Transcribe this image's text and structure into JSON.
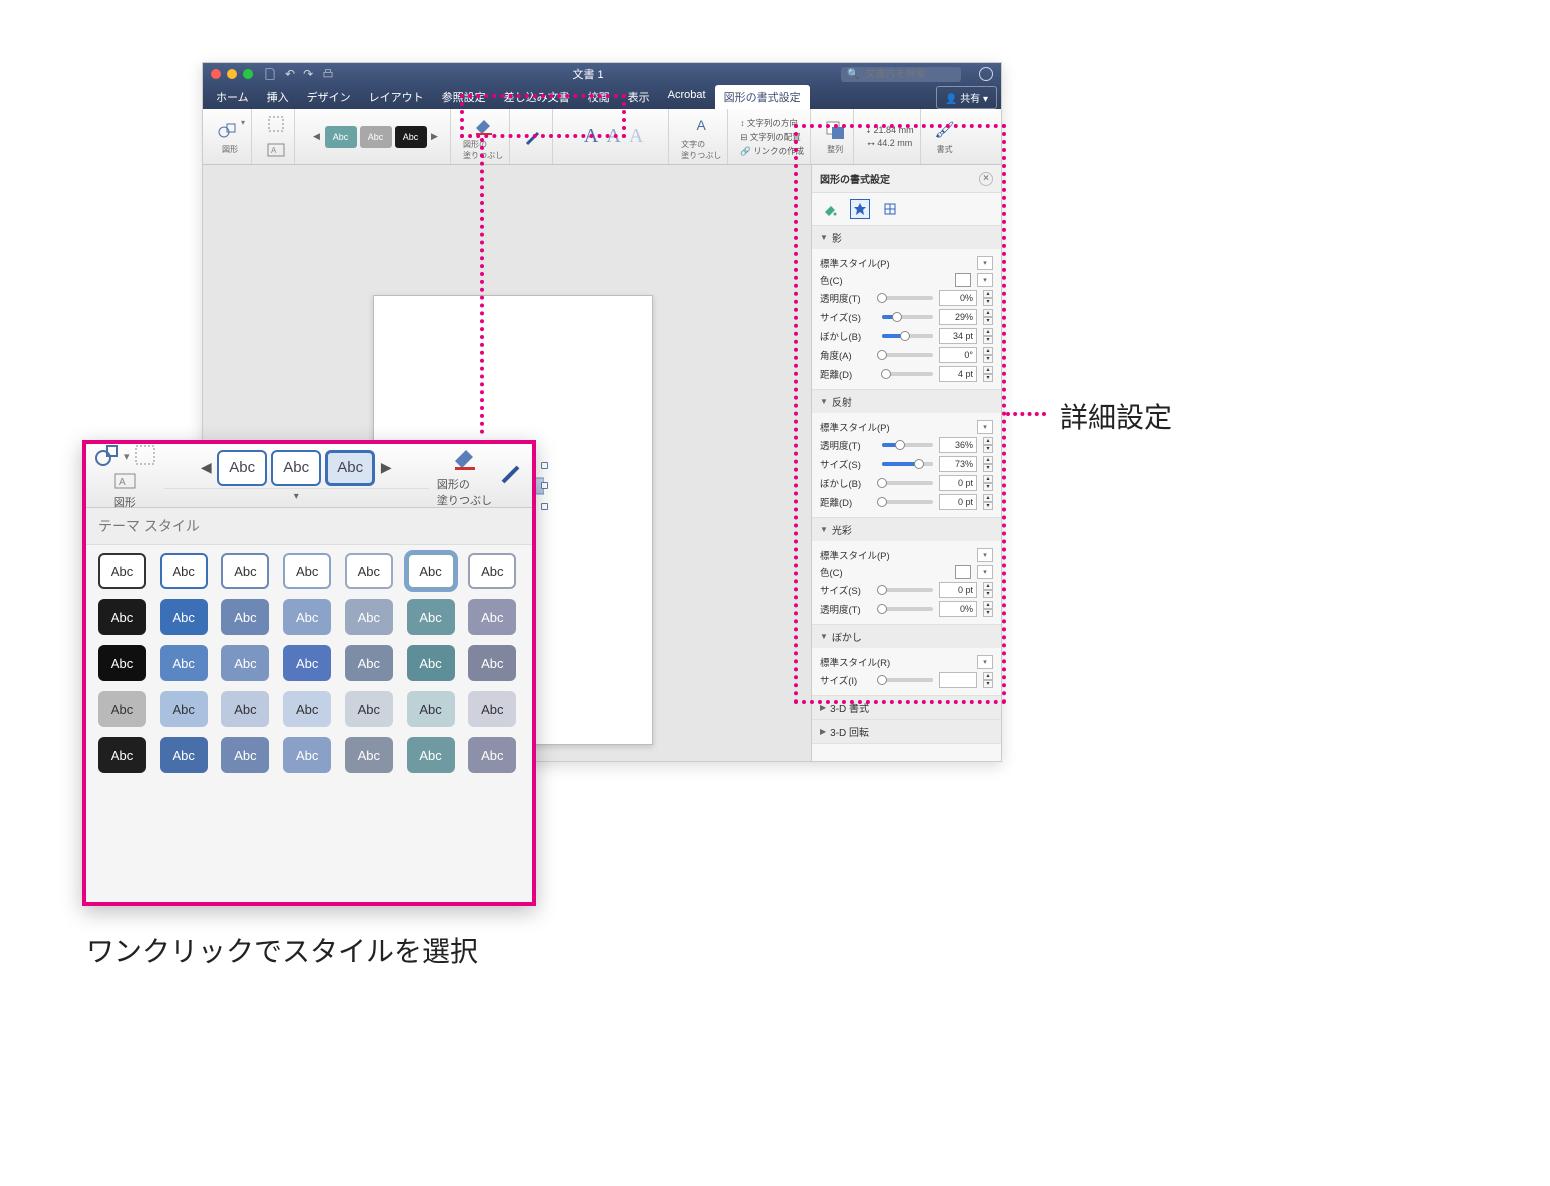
{
  "window": {
    "doc_title": "文書 1",
    "search_placeholder": "文書内を検索",
    "share_label": "共有",
    "tabs": [
      "ホーム",
      "挿入",
      "デザイン",
      "レイアウト",
      "参照設定",
      "差し込み文書",
      "校閲",
      "表示",
      "Acrobat",
      "図形の書式設定"
    ],
    "active_tab_index": 9
  },
  "ribbon": {
    "shape_group": "図形",
    "style_previews": [
      {
        "bg": "#6aa3a3",
        "txt": "Abc"
      },
      {
        "bg": "#a8a8a8",
        "txt": "Abc"
      },
      {
        "bg": "#1b1b1b",
        "txt": "Abc"
      }
    ],
    "fill_label": "図形の\n塗りつぶし",
    "wordart_label": "文字の\n塗りつぶし",
    "text_group": {
      "dir": "文字列の方向",
      "align": "文字列の配置",
      "link": "リンクの作成"
    },
    "arrange_label": "整列",
    "size": {
      "w": "21.84 mm",
      "h": "44.2 mm"
    },
    "format_label": "書式"
  },
  "format_pane": {
    "title": "図形の書式設定",
    "sections": {
      "shadow": {
        "title": "影",
        "rows": {
          "preset": "標準スタイル(P)",
          "color": "色(C)",
          "transparency": {
            "label": "透明度(T)",
            "val": "0%",
            "pct": 0
          },
          "size": {
            "label": "サイズ(S)",
            "val": "29%",
            "pct": 29
          },
          "blur": {
            "label": "ぼかし(B)",
            "val": "34 pt",
            "pct": 45
          },
          "angle": {
            "label": "角度(A)",
            "val": "0°",
            "pct": 0
          },
          "distance": {
            "label": "距離(D)",
            "val": "4 pt",
            "pct": 8
          }
        }
      },
      "reflection": {
        "title": "反射",
        "rows": {
          "preset": "標準スタイル(P)",
          "transparency": {
            "label": "透明度(T)",
            "val": "36%",
            "pct": 36
          },
          "size": {
            "label": "サイズ(S)",
            "val": "73%",
            "pct": 73
          },
          "blur": {
            "label": "ぼかし(B)",
            "val": "0 pt",
            "pct": 0
          },
          "distance": {
            "label": "距離(D)",
            "val": "0 pt",
            "pct": 0
          }
        }
      },
      "glow": {
        "title": "光彩",
        "rows": {
          "preset": "標準スタイル(P)",
          "color": "色(C)",
          "size": {
            "label": "サイズ(S)",
            "val": "0 pt",
            "pct": 0
          },
          "transparency": {
            "label": "透明度(T)",
            "val": "0%",
            "pct": 0
          }
        }
      },
      "softedge": {
        "title": "ぼかし",
        "rows": {
          "preset": "標準スタイル(R)",
          "size": {
            "label": "サイズ(I)",
            "val": "",
            "pct": 0
          }
        }
      },
      "bevel": {
        "title": "3-D 書式"
      },
      "rotation": {
        "title": "3-D 回転"
      }
    }
  },
  "popup": {
    "toolbar": {
      "shape_label": "図形",
      "fill_label": "図形の\n塗りつぶし",
      "styles": [
        "Abc",
        "Abc",
        "Abc"
      ]
    },
    "section_title": "テーマ スタイル",
    "grid": [
      [
        {
          "bg": "#fff",
          "border": "#333",
          "t": "Abc",
          "tw": true
        },
        {
          "bg": "#fff",
          "border": "#3b6fb6",
          "t": "Abc",
          "tw": true
        },
        {
          "bg": "#fff",
          "border": "#6e88b5",
          "t": "Abc",
          "tw": true
        },
        {
          "bg": "#fff",
          "border": "#8ca3c9",
          "t": "Abc",
          "tw": true
        },
        {
          "bg": "#fff",
          "border": "#9aa9bf",
          "t": "Abc",
          "tw": true
        },
        {
          "bg": "#fff",
          "border": "#7fa6b3",
          "t": "Abc",
          "tw": true,
          "sel": true
        },
        {
          "bg": "#fff",
          "border": "#9a9fb8",
          "t": "Abc",
          "tw": true
        }
      ],
      [
        {
          "bg": "#1b1b1b",
          "t": "Abc"
        },
        {
          "bg": "#3b6fb6",
          "t": "Abc"
        },
        {
          "bg": "#6e88b5",
          "t": "Abc"
        },
        {
          "bg": "#8ca3c9",
          "t": "Abc"
        },
        {
          "bg": "#9aa9bf",
          "t": "Abc"
        },
        {
          "bg": "#6d9aa2",
          "t": "Abc"
        },
        {
          "bg": "#9296b0",
          "t": "Abc"
        }
      ],
      [
        {
          "bg": "#0f0f0f",
          "t": "Abc"
        },
        {
          "bg": "#5a86c4",
          "t": "Abc"
        },
        {
          "bg": "#7c96c2",
          "t": "Abc"
        },
        {
          "bg": "#5577bd",
          "t": "Abc"
        },
        {
          "bg": "#7d8da5",
          "t": "Abc"
        },
        {
          "bg": "#5e8f99",
          "t": "Abc"
        },
        {
          "bg": "#81869f",
          "t": "Abc"
        }
      ],
      [
        {
          "bg": "#b9b9b9",
          "t": "Abc",
          "tw": true
        },
        {
          "bg": "#a9c0df",
          "t": "Abc",
          "tw": true
        },
        {
          "bg": "#bcc9de",
          "t": "Abc",
          "tw": true
        },
        {
          "bg": "#c3d1e6",
          "t": "Abc",
          "tw": true
        },
        {
          "bg": "#cdd3dd",
          "t": "Abc",
          "tw": true
        },
        {
          "bg": "#bcd2d7",
          "t": "Abc",
          "tw": true
        },
        {
          "bg": "#cfd1dd",
          "t": "Abc",
          "tw": true
        }
      ],
      [
        {
          "bg": "#1f1f1f",
          "t": "Abc"
        },
        {
          "bg": "#486fa9",
          "t": "Abc"
        },
        {
          "bg": "#7189b3",
          "t": "Abc"
        },
        {
          "bg": "#8aa0c7",
          "t": "Abc"
        },
        {
          "bg": "#8893a6",
          "t": "Abc"
        },
        {
          "bg": "#6f9aa2",
          "t": "Abc"
        },
        {
          "bg": "#8c90a8",
          "t": "Abc"
        }
      ]
    ]
  },
  "annotations": {
    "detail": "詳細設定",
    "oneclick": "ワンクリックでスタイルを選択"
  }
}
